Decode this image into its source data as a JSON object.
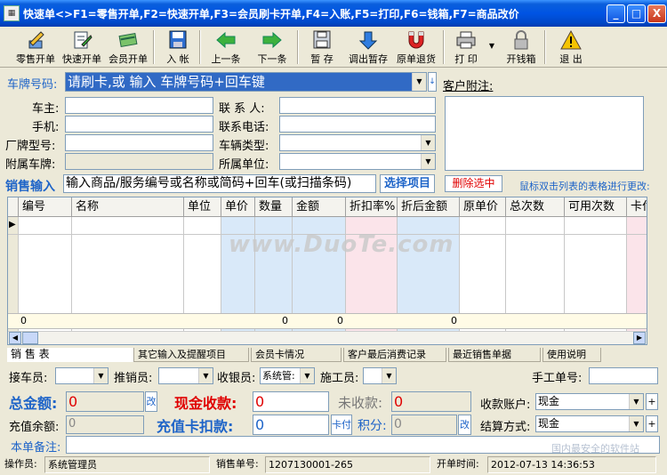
{
  "window": {
    "title": "快速单<>F1=零售开单,F2=快速开单,F3=会员刷卡开单,F4=入账,F5=打印,F6=钱箱,F7=商品改价",
    "min_label": "_",
    "max_label": "□",
    "close_label": "X"
  },
  "toolbar": {
    "retail_label": "零售开单",
    "quick_label": "快速开单",
    "member_label": "会员开单",
    "post_label": "入 帐",
    "prev_label": "上一条",
    "next_label": "下一条",
    "hold_label": "暂 存",
    "recall_label": "调出暂存",
    "return_label": "原单退货",
    "print_label": "打 印",
    "drawer_label": "开钱箱",
    "exit_label": "退 出"
  },
  "form": {
    "plate_label": "车牌号码:",
    "plate_input": "请刷卡,或 输入 车牌号码+回车键",
    "customer_note_label": "客户附注:",
    "owner_label": "车主:",
    "contact_label": "联 系 人:",
    "mobile_label": "手机:",
    "phone_label": "联系电话:",
    "model_label": "厂牌型号:",
    "type_label": "车辆类型:",
    "attached_label": "附属车牌:",
    "unit_label": "所属单位:"
  },
  "sales_input": {
    "label": "销售输入",
    "input": "输入商品/服务编号或名称或简码+回车(或扫描条码)",
    "select_btn": "选择项目",
    "delete_btn": "删除选中",
    "hint": "鼠标双击列表的表格进行更改:"
  },
  "grid": {
    "headers": [
      "编号",
      "名称",
      "单位",
      "单价",
      "数量",
      "金额",
      "折扣率%",
      "折后金额",
      "原单价",
      "总次数",
      "可用次数",
      "卡付"
    ],
    "footer_first": "0",
    "footer_qty": "0",
    "footer_amount": "0",
    "footer_disc": "0",
    "watermark": "www.DuoTe.com"
  },
  "tabs": [
    "销 售 表",
    "其它输入及提醒项目",
    "会员卡情况",
    "客户最后消费记录",
    "最近销售单据",
    "使用说明"
  ],
  "staff": {
    "receiver_label": "接车员:",
    "seller_label": "推销员:",
    "cashier_label": "收银员:",
    "cashier_value": "系统管:",
    "worker_label": "施工员:",
    "manual_no_label": "手工单号:"
  },
  "totals": {
    "total_label": "总金额:",
    "total_value": "0",
    "change_btn": "改",
    "cash_label": "现金收款:",
    "cash_value": "0",
    "unpaid_label": "未收款:",
    "unpaid_value": "0",
    "account_label": "收款账户:",
    "account_value": "现金",
    "recharge_label": "充值余额:",
    "recharge_value": "0",
    "card_label": "充值卡扣款:",
    "card_value": "0",
    "card_btn": "卡付",
    "points_label": "积分:",
    "points_value": "0",
    "points_btn": "改",
    "settle_label": "结算方式:",
    "settle_value": "现金",
    "note_label": "本单备注:",
    "plus": "+"
  },
  "status": {
    "operator_label": "操作员:",
    "operator_value": "系统管理员",
    "order_label": "销售单号:",
    "order_value": "1207130001-265",
    "open_label": "开单时间:",
    "open_value": "2012-07-13 14:36:53"
  },
  "watermark2": "国内最安全的软件站",
  "colors": {
    "accent_blue": "#1e64c8",
    "total_red": "#e00000",
    "title_blue": "#0054e3"
  }
}
